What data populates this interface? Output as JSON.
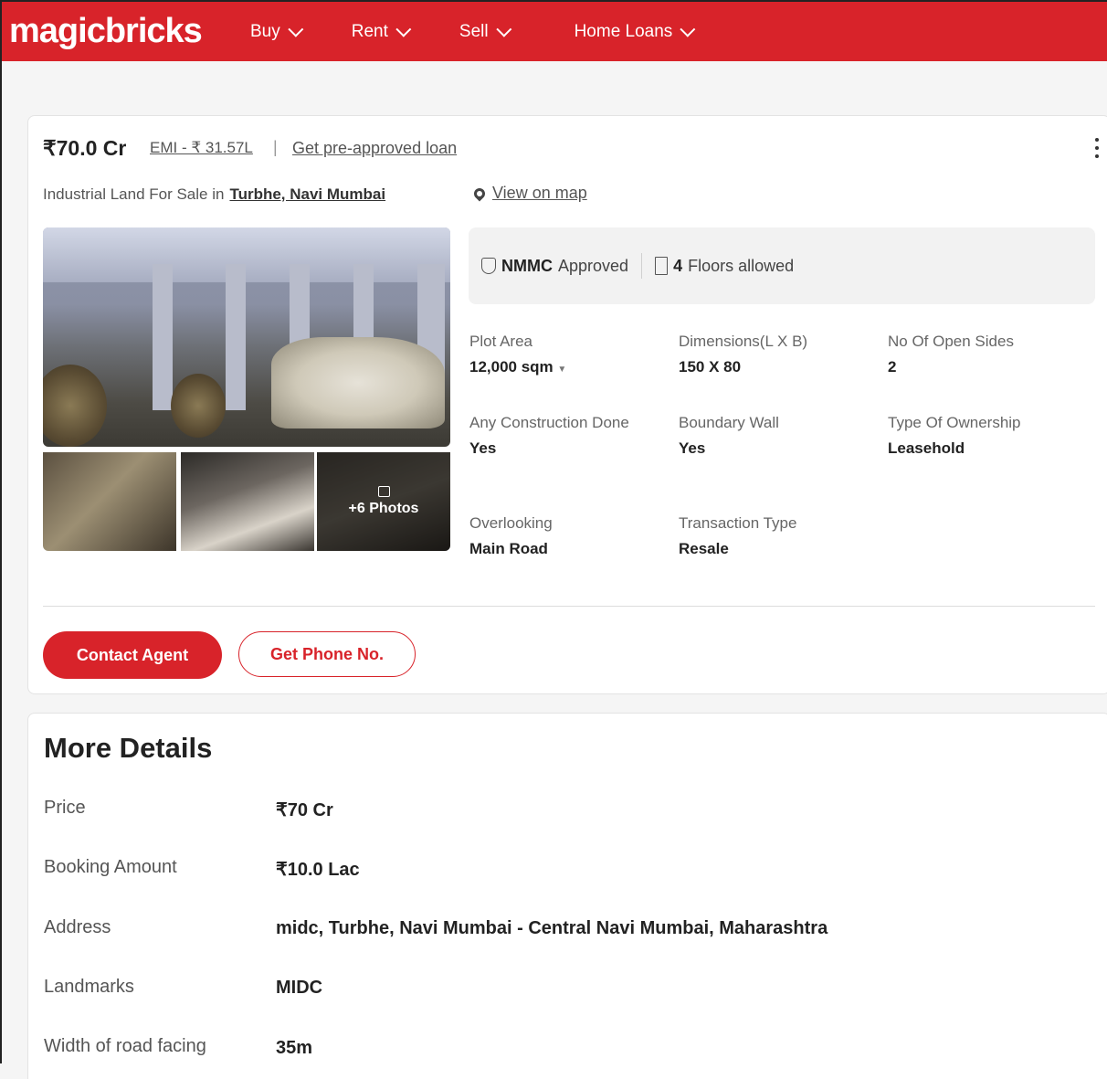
{
  "header": {
    "logo": "magicbricks",
    "nav": [
      "Buy",
      "Rent",
      "Sell",
      "Home Loans"
    ]
  },
  "listing": {
    "price": "₹70.0 Cr",
    "emi": "EMI - ₹ 31.57L",
    "separator": "|",
    "preapproved": "Get pre-approved loan",
    "subtitle_prefix": "Industrial Land For Sale in",
    "locality": "Turbhe, Navi Mumbai",
    "view_on_map": "View on map",
    "photos_label": "+6 Photos",
    "badge1_bold": "NMMC",
    "badge1_text": "Approved",
    "badge2_bold": "4",
    "badge2_text": "Floors allowed",
    "specs": [
      {
        "label": "Plot Area",
        "value": "12,000 sqm"
      },
      {
        "label": "Dimensions(L X B)",
        "value": "150 X 80"
      },
      {
        "label": "No Of Open Sides",
        "value": "2"
      },
      {
        "label": "Any Construction Done",
        "value": "Yes"
      },
      {
        "label": "Boundary Wall",
        "value": "Yes"
      },
      {
        "label": "Type Of Ownership",
        "value": "Leasehold"
      },
      {
        "label": "Overlooking",
        "value": "Main Road"
      },
      {
        "label": "Transaction Type",
        "value": "Resale"
      }
    ],
    "contact_agent": "Contact Agent",
    "get_phone": "Get Phone No."
  },
  "more_details": {
    "title": "More Details",
    "rows": [
      {
        "label": "Price",
        "value": "₹70 Cr"
      },
      {
        "label": "Booking Amount",
        "value": "₹10.0 Lac"
      },
      {
        "label": "Address",
        "value": "midc, Turbhe, Navi Mumbai - Central Navi Mumbai, Maharashtra"
      },
      {
        "label": "Landmarks",
        "value": "MIDC"
      },
      {
        "label": "Width of road facing",
        "value": "35m"
      }
    ]
  },
  "colors": {
    "brand": "#d8232a"
  }
}
